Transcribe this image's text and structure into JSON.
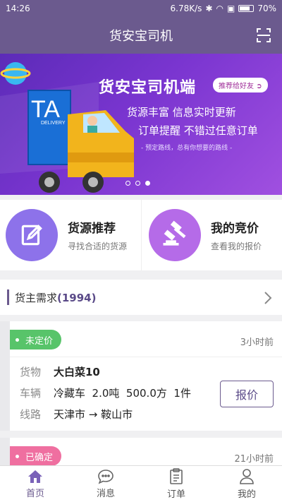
{
  "status": {
    "time": "14:26",
    "speed": "6.78K/s",
    "battery": "70%"
  },
  "header": {
    "title": "货安宝司机"
  },
  "banner": {
    "title": "货安宝司机端",
    "share_label": "推荐给好友",
    "line1": "货源丰富 信息实时更新",
    "line2": "订单提醒 不错过任意订单",
    "line3": "- 预定路线，总有你想要的路线 -",
    "truck_text": "TA",
    "truck_subtext": "DELIVERY",
    "dots_count": 3,
    "active_dot": 3
  },
  "quick": [
    {
      "title": "货源推荐",
      "sub": "寻找合适的货源",
      "color": "#8d72ea",
      "icon": "edit-icon"
    },
    {
      "title": "我的竞价",
      "sub": "查看我的报价",
      "color": "#b56be8",
      "icon": "gavel-icon"
    }
  ],
  "demand": {
    "title": "货主需求",
    "count": "(1994)"
  },
  "orders": [
    {
      "tag": "未定价",
      "tag_color": "#58c46a",
      "time": "3小时前",
      "cargo_label": "货物",
      "cargo": "大白菜10",
      "vehicle_label": "车辆",
      "vehicle": "冷藏车  2.0吨  500.0方  1件",
      "route_label": "线路",
      "route": "天津市 → 鞍山市",
      "button": "报价"
    },
    {
      "tag": "已确定",
      "tag_color": "#ef6fa0",
      "time": "21小时前"
    }
  ],
  "tabs": [
    {
      "label": "首页",
      "icon": "home-icon",
      "active": true
    },
    {
      "label": "消息",
      "icon": "message-icon",
      "active": false
    },
    {
      "label": "订单",
      "icon": "order-icon",
      "active": false
    },
    {
      "label": "我的",
      "icon": "profile-icon",
      "active": false
    }
  ]
}
